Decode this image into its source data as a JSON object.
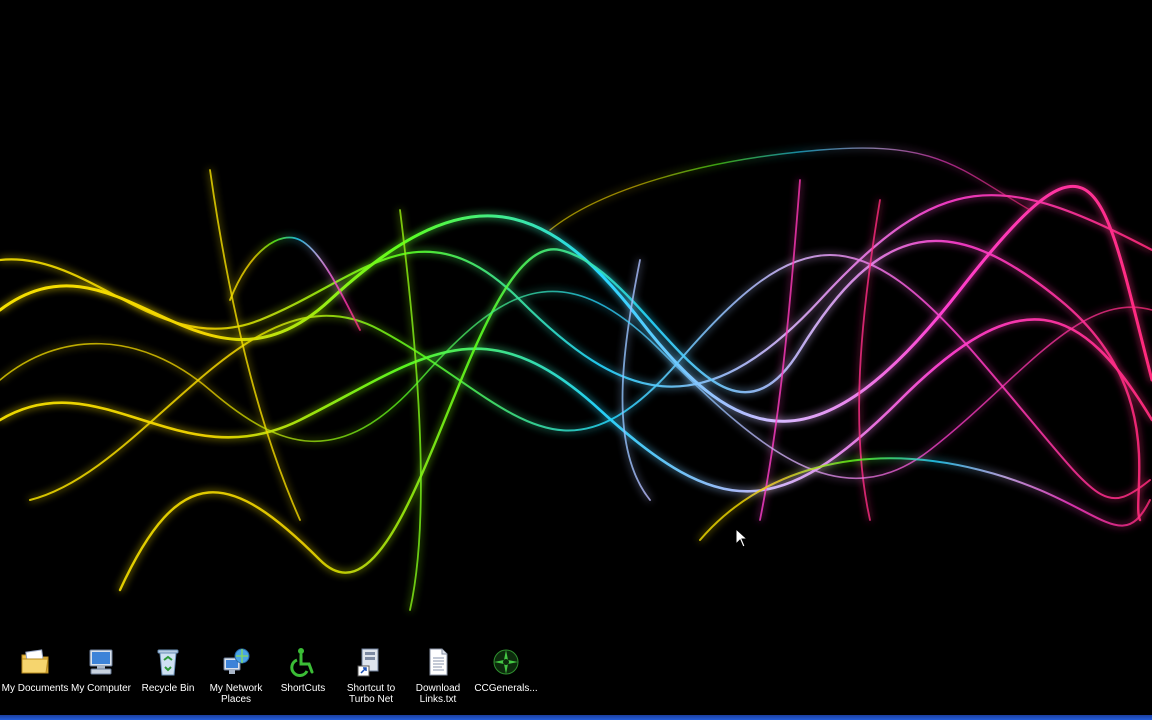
{
  "desktop": {
    "wallpaper_name": "neon-light-streaks",
    "background_color": "#000000",
    "accent_colors": [
      "#f5e000",
      "#5cff1e",
      "#25d6ff",
      "#d9b8ff",
      "#ff3fd0"
    ],
    "icons": [
      {
        "label": "My Documents",
        "icon": "folder-documents-icon"
      },
      {
        "label": "My Computer",
        "icon": "computer-icon"
      },
      {
        "label": "Recycle Bin",
        "icon": "recycle-bin-icon"
      },
      {
        "label": "My Network Places",
        "icon": "network-places-icon"
      },
      {
        "label": "ShortCuts",
        "icon": "accessibility-shortcut-icon"
      },
      {
        "label": "Shortcut to Turbo Net",
        "icon": "shortcut-turbo-net-icon"
      },
      {
        "label": "Download Links.txt",
        "icon": "text-file-icon"
      },
      {
        "label": "CCGenerals...",
        "icon": "cc-generals-icon"
      }
    ]
  }
}
